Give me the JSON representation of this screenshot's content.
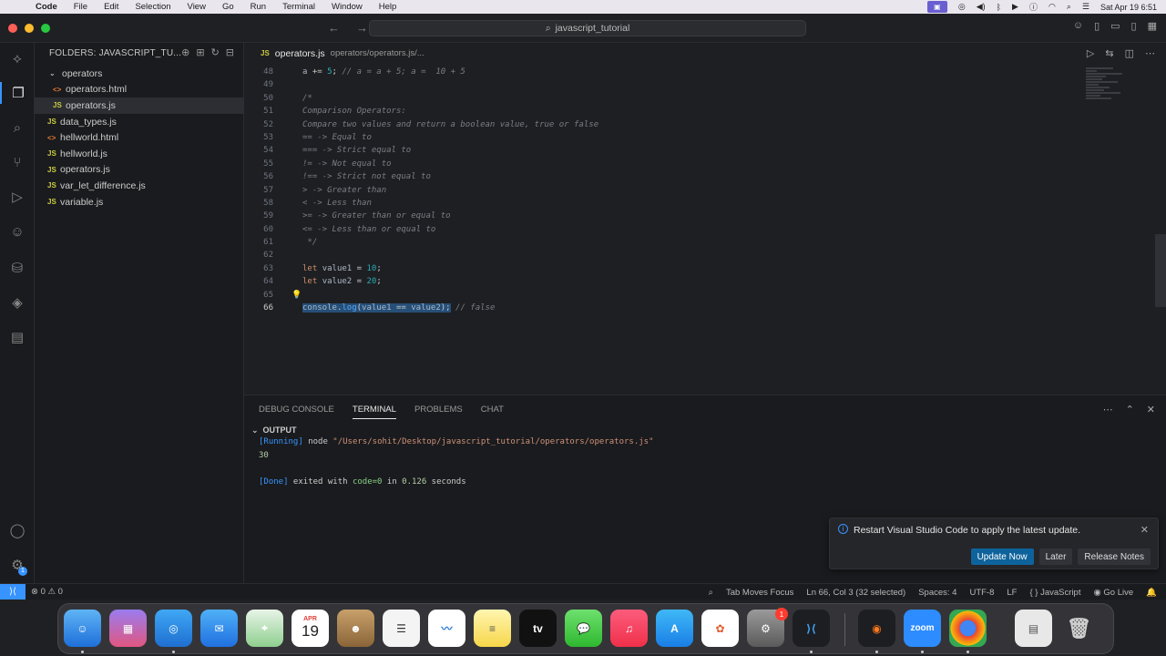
{
  "menubar": {
    "apple_icon": "apple-icon",
    "app_name": "Code",
    "items": [
      "File",
      "Edit",
      "Selection",
      "View",
      "Go",
      "Run",
      "Terminal",
      "Window",
      "Help"
    ],
    "clock": "Sat Apr 19  6:51"
  },
  "titlebar": {
    "search_text": "javascript_tutorial"
  },
  "sidebar": {
    "header": "FOLDERS: JAVASCRIPT_TU...",
    "items": [
      {
        "label": "operators",
        "kind": "folder",
        "depth": 1
      },
      {
        "label": "operators.html",
        "kind": "html",
        "depth": 2
      },
      {
        "label": "operators.js",
        "kind": "js",
        "depth": 2,
        "selected": true
      },
      {
        "label": "data_types.js",
        "kind": "js",
        "depth": 1
      },
      {
        "label": "hellworld.html",
        "kind": "html",
        "depth": 1
      },
      {
        "label": "hellworld.js",
        "kind": "js",
        "depth": 1
      },
      {
        "label": "operators.js",
        "kind": "js",
        "depth": 1
      },
      {
        "label": "var_let_difference.js",
        "kind": "js",
        "depth": 1
      },
      {
        "label": "variable.js",
        "kind": "js",
        "depth": 1
      }
    ]
  },
  "editor": {
    "tab_icon": "JS",
    "tab_name": "operators.js",
    "tab_path": "operators/operators.js/...",
    "lines": [
      {
        "n": "48",
        "text": "a += 5; // a = a + 5; a =  10 + 5"
      },
      {
        "n": "49",
        "text": ""
      },
      {
        "n": "50",
        "text": "/*"
      },
      {
        "n": "51",
        "text": "Comparison Operators:"
      },
      {
        "n": "52",
        "text": "Compare two values and return a boolean value, true or false"
      },
      {
        "n": "53",
        "text": "== -> Equal to"
      },
      {
        "n": "54",
        "text": "=== -> Strict equal to"
      },
      {
        "n": "55",
        "text": "!= -> Not equal to"
      },
      {
        "n": "56",
        "text": "!== -> Strict not equal to"
      },
      {
        "n": "57",
        "text": "> -> Greater than"
      },
      {
        "n": "58",
        "text": "< -> Less than"
      },
      {
        "n": "59",
        "text": ">= -> Greater than or equal to"
      },
      {
        "n": "60",
        "text": "<= -> Less than or equal to"
      },
      {
        "n": "61",
        "text": " */"
      },
      {
        "n": "62",
        "text": ""
      },
      {
        "n": "63",
        "text": "let value1 = 10;"
      },
      {
        "n": "64",
        "text": "let value2 = 20;"
      },
      {
        "n": "65",
        "text": ""
      },
      {
        "n": "66",
        "text": "console.log(value1 == value2); // false"
      }
    ]
  },
  "panel": {
    "tabs": [
      "DEBUG CONSOLE",
      "TERMINAL",
      "PROBLEMS",
      "CHAT"
    ],
    "active_tab": "TERMINAL",
    "output_label": "OUTPUT",
    "run_tag": "[Running]",
    "run_cmd": "node ",
    "run_path": "\"/Users/sohit/Desktop/javascript_tutorial/operators/operators.js\"",
    "result": "30",
    "done_tag": "[Done]",
    "done_text": " exited with ",
    "done_code": "code=0",
    "done_in": " in ",
    "done_time": "0.126",
    "done_unit": " seconds"
  },
  "notification": {
    "message": "Restart Visual Studio Code to apply the latest update.",
    "buttons": [
      "Update Now",
      "Later",
      "Release Notes"
    ]
  },
  "statusbar": {
    "problems": "⊗ 0 ⚠ 0",
    "tab_moves_focus": "Tab Moves Focus",
    "cursor": "Ln 66, Col 3 (32 selected)",
    "spaces": "Spaces: 4",
    "encoding": "UTF-8",
    "eol": "LF",
    "language": "JavaScript",
    "go_live": "Go Live"
  },
  "dock": {
    "calendar_month": "APR",
    "calendar_day": "19",
    "settings_badge": "1",
    "tv_label": "tv",
    "zoom_label": "zoom"
  },
  "colors": {
    "accent": "#3794ff",
    "js_icon": "#cbcb41",
    "html_icon": "#e37933"
  }
}
